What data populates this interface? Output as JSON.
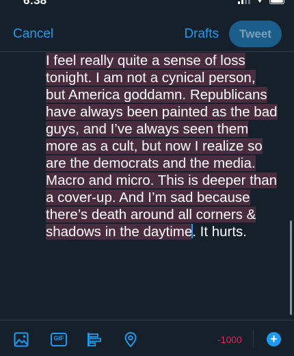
{
  "status_bar": {
    "time": "6:38"
  },
  "nav": {
    "cancel_label": "Cancel",
    "drafts_label": "Drafts",
    "tweet_label": "Tweet"
  },
  "compose": {
    "lines": [
      "I feel really quite a sense of loss",
      "tonight. I am not a cynical person,",
      "but America goddamn. Republicans",
      "have always been painted as the bad",
      "guys, and I’ve always seen them",
      "more as a cult, but now I realize so",
      "are the democrats and the media.",
      "Macro and micro. This is deeper than",
      "a cover-up. And I’m sad because",
      "there’s death around all corners &",
      "shadows in the daytime"
    ],
    "trailing_text": ". It hurts.",
    "selection_color": "#4a2c3f"
  },
  "toolbar": {
    "icons": [
      "image-icon",
      "gif-icon",
      "poll-icon",
      "location-icon"
    ],
    "gif_label": "GIF",
    "char_count": "-1000",
    "add_label": "+",
    "accent_color": "#1d9bf0",
    "count_color": "#e0245e"
  }
}
